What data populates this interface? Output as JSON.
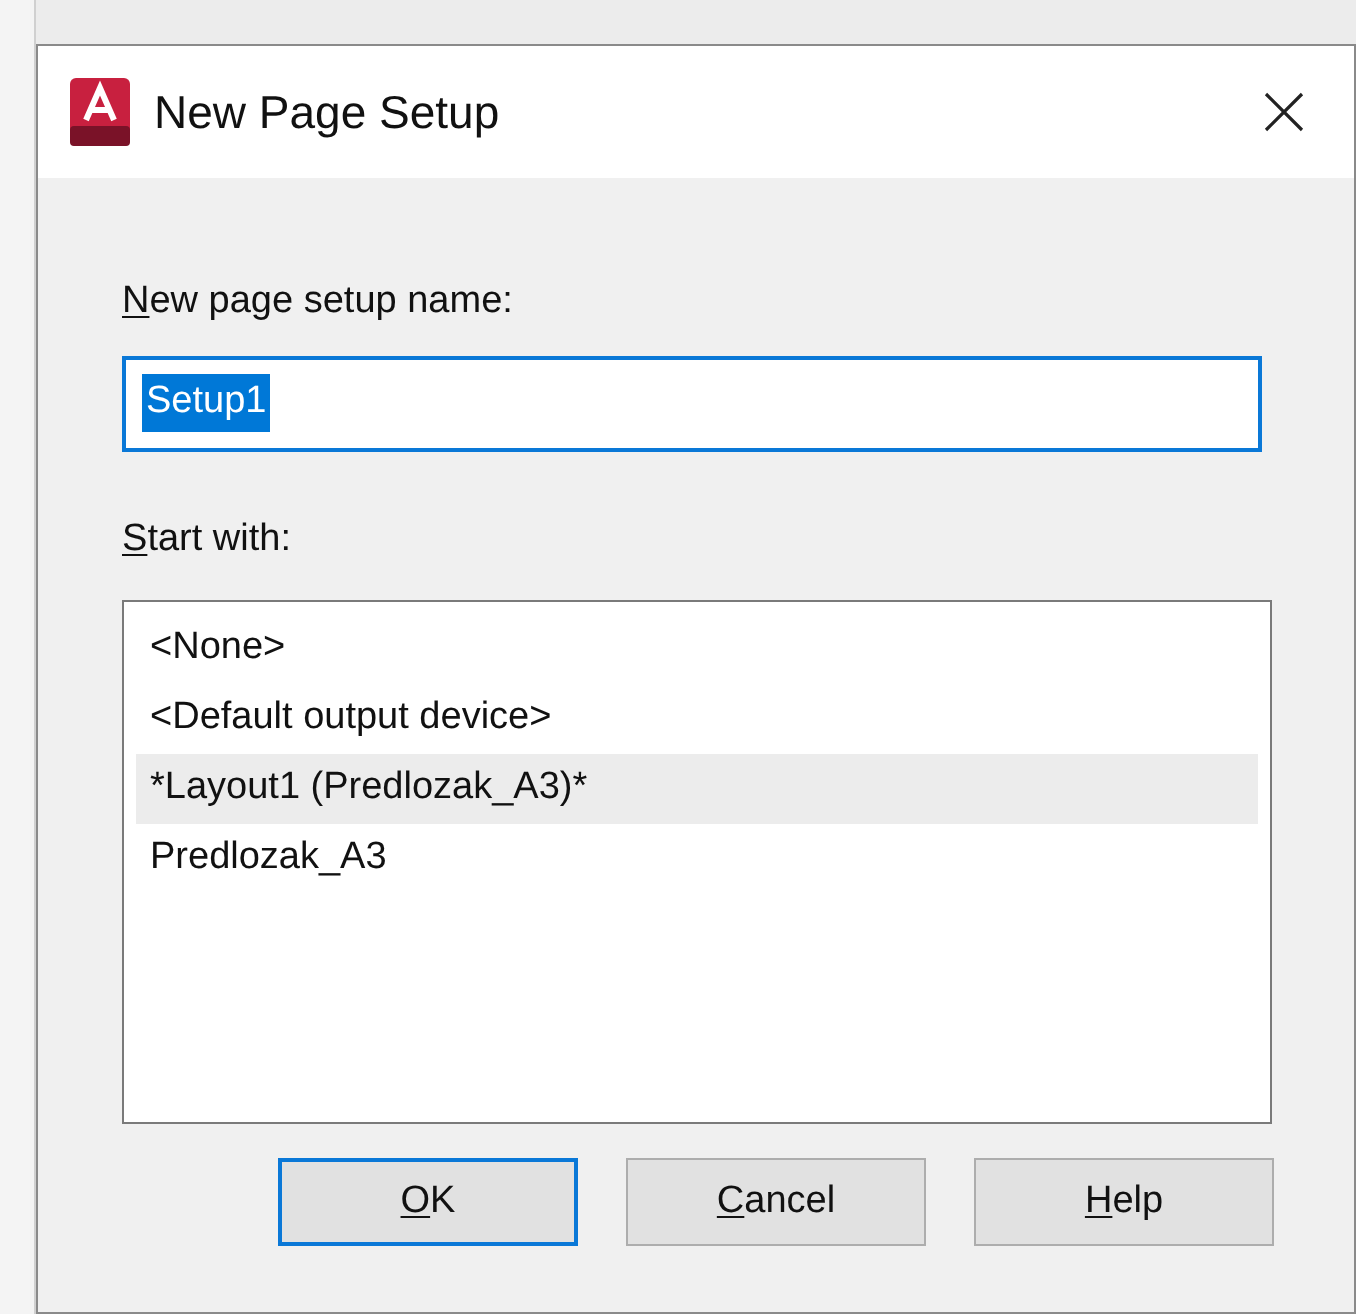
{
  "window": {
    "title": "New Page Setup"
  },
  "name_field": {
    "label": {
      "key": "N",
      "rest": "ew page setup name:"
    },
    "value": "Setup1"
  },
  "start_with": {
    "label": {
      "key": "S",
      "rest": "tart with:"
    },
    "items": [
      {
        "text": "<None>",
        "selected": false
      },
      {
        "text": "<Default output device>",
        "selected": false
      },
      {
        "text": "*Layout1 (Predlozak_A3)*",
        "selected": true
      },
      {
        "text": "Predlozak_A3",
        "selected": false
      }
    ]
  },
  "buttons": [
    {
      "key": "O",
      "rest": "K",
      "default": true
    },
    {
      "key": "C",
      "rest": "ancel",
      "default": false
    },
    {
      "key": "H",
      "rest": "elp",
      "default": false
    }
  ]
}
